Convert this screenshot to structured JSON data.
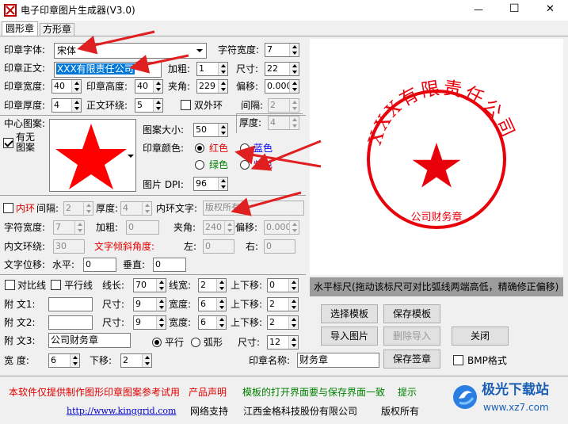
{
  "window": {
    "title": "电子印章图片生成器(V3.0)",
    "minimize": "—",
    "maximize": "☐",
    "close": "✕"
  },
  "tabs": [
    {
      "label": "圆形章"
    },
    {
      "label": "方形章"
    }
  ],
  "form": {
    "font_label": "印章字体:",
    "font_value": "宋体",
    "char_width_label": "字符宽度:",
    "char_width": "7",
    "text_label": "印章正文:",
    "text_value": "XXX有限责任公司",
    "bold_label": "加粗:",
    "bold": "1",
    "size_label": "尺寸:",
    "size": "22",
    "width_label": "印章宽度:",
    "width": "40",
    "height_label": "印章高度:",
    "height": "40",
    "angle_label": "夹角:",
    "angle": "229",
    "offset_label": "偏移:",
    "offset": "0.000",
    "thickness_label": "印章厚度:",
    "thickness": "4",
    "ring_label": "正文环绕:",
    "ring": "5",
    "double_ring_label": "双外环",
    "gap_label": "间隔:",
    "gap": "2",
    "thick2_label": "厚度:",
    "thick2": "4",
    "center_label": "中心图案:",
    "has_pattern_label": "有无图案",
    "pattern_size_label": "图案大小:",
    "pattern_size": "50",
    "color_label": "印章颜色:",
    "color_red": "红色",
    "color_blue": "蓝色",
    "color_green": "绿色",
    "color_purple": "紫色",
    "dpi_label": "图片 DPI:",
    "dpi": "96",
    "inner_ring_label": "内环",
    "inner_gap_label": "间隔:",
    "inner_gap": "2",
    "inner_thick_label": "厚度:",
    "inner_thick": "4",
    "inner_text_label": "内环文字:",
    "inner_text": "版权所有",
    "ci_width_label": "字符宽度:",
    "ci_width": "7",
    "ci_bold_label": "加粗:",
    "ci_bold": "0",
    "ci_angle_label": "夹角:",
    "ci_angle": "240",
    "ci_offset_label": "偏移:",
    "ci_offset": "0.000",
    "inner_ring2_label": "内文环绕:",
    "inner_ring2": "30",
    "tilt_label": "文字倾斜角度:",
    "left_label": "左:",
    "left": "0",
    "right_label": "右:",
    "right": "0",
    "shift_label": "文字位移:",
    "horiz_label": "水平:",
    "horiz": "0",
    "vert_label": "垂直:",
    "vert": "0",
    "compare_label": "对比线",
    "parallel_label": "平行线",
    "line_len_label": "线长:",
    "line_len": "70",
    "line_w_label": "线宽:",
    "line_w": "2",
    "updown_label": "上下移:",
    "updown": "0",
    "sub1_label": "附    文1:",
    "sub1": "",
    "sub1_size_label": "尺寸:",
    "sub1_size": "9",
    "sub1_w_label": "宽度:",
    "sub1_w": "6",
    "sub1_ud_label": "上下移:",
    "sub1_ud": "2",
    "sub2_label": "附    文2:",
    "sub2": "",
    "sub2_size_label": "尺寸:",
    "sub2_size": "9",
    "sub2_w_label": "宽度:",
    "sub2_w": "6",
    "sub2_ud_label": "上下移:",
    "sub2_ud": "2",
    "sub3_label": "附    文3:",
    "sub3": "公司财务章",
    "flat_label": "平行",
    "arc_label": "弧形",
    "sub3_size_label": "尺寸:",
    "sub3_size": "12",
    "bw_label": "宽    度:",
    "bw": "6",
    "bdown_label": "下移:",
    "bdown": "2",
    "seal_name_label": "印章名称:",
    "seal_name": "财务章"
  },
  "preview": {
    "top_text": "XXX有限责任公司",
    "bottom_text": "公司财务章",
    "color": "#e8000b"
  },
  "ruler": {
    "text": "水平标尺(拖动该标尺可对比弧线两端高低，精确修正偏移)"
  },
  "buttons": {
    "choose_template": "选择模板",
    "save_template": "保存模板",
    "import_image": "导入图片",
    "delete_import": "删除导入",
    "close": "关闭",
    "save_seal": "保存签章",
    "bmp_label": "BMP格式"
  },
  "footer": {
    "line1a": "本软件仅提供制作图形印章图案参考试用",
    "line1b": "产品声明",
    "line1c": "模板的打开界面要与保存界面一致",
    "line1d": "提示",
    "url": "http://www.kinggrid.com",
    "support": "网络支持",
    "company": "江西金格科技股份有限公司",
    "rights": "版权所有"
  },
  "watermark": {
    "text": "极光下载站",
    "url": "www.xz7.com"
  },
  "colors": {
    "arrow": "#e02020",
    "seal": "#e8000b",
    "ruler_bg": "#9c9c9c"
  }
}
